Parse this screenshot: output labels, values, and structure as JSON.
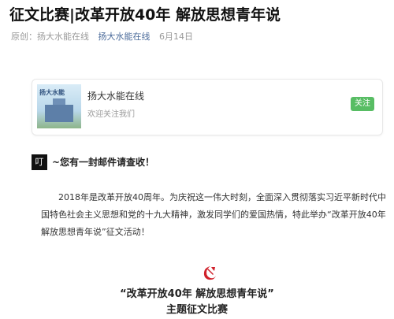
{
  "article": {
    "title": "征文比赛|改革开放40年 解放思想青年说",
    "meta": {
      "original": "原创：",
      "author": "扬大水能在线",
      "account": "扬大水能在线",
      "date": "6月14日"
    }
  },
  "card": {
    "name": "扬大水能在线",
    "desc": "欢迎关注我们",
    "follow_label": "关注",
    "thumb_text": "扬大水能"
  },
  "notice": {
    "tag": "叮",
    "text": "~您有一封邮件请查收！"
  },
  "body": {
    "paragraph": "2018年是改革开放40周年。为庆祝这一伟大时刻，全面深入贯彻落实习近平新时代中国特色社会主义思想和党的十九大精神，激发同学们的爱国热情，特此举办“改革开放40年 解放思想青年说”征文活动！"
  },
  "banner": {
    "title": "“改革开放40年 解放思想青年说”",
    "subtitle": "主题征文比赛"
  },
  "colors": {
    "follow_button": "#3cb24a",
    "link": "#4a6a9a",
    "emblem": "#d0202a"
  }
}
